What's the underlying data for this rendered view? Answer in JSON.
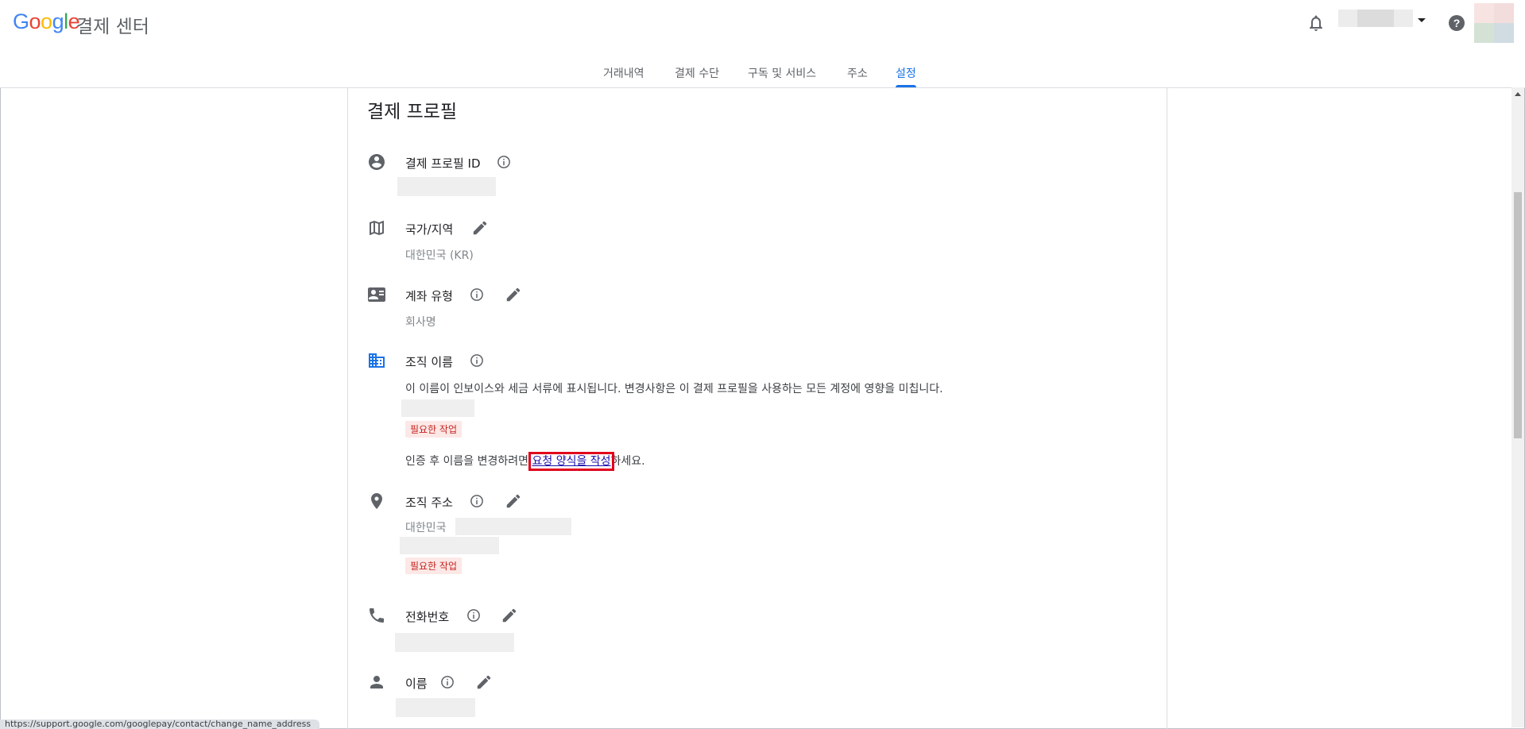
{
  "header": {
    "logo_letters": [
      {
        "ch": "G",
        "color": "#4285F4"
      },
      {
        "ch": "o",
        "color": "#EA4335"
      },
      {
        "ch": "o",
        "color": "#FBBC05"
      },
      {
        "ch": "g",
        "color": "#4285F4"
      },
      {
        "ch": "l",
        "color": "#34A853"
      },
      {
        "ch": "e",
        "color": "#EA4335"
      }
    ],
    "product_name": "결제 센터",
    "icons": {
      "notifications": "bell-icon",
      "help": "help-icon",
      "account_menu": "chevron-down-icon"
    }
  },
  "tabs": [
    {
      "label": "거래내역",
      "active": false
    },
    {
      "label": "결제 수단",
      "active": false
    },
    {
      "label": "구독 및 서비스",
      "active": false
    },
    {
      "label": "주소",
      "active": false
    },
    {
      "label": "설정",
      "active": true
    }
  ],
  "section": {
    "title": "결제 프로필",
    "profile_id": {
      "label": "결제 프로필 ID"
    },
    "country": {
      "label": "국가/지역",
      "value": "대한민국 (KR)"
    },
    "account_type": {
      "label": "계좌 유형",
      "value": "회사명"
    },
    "org_name": {
      "label": "조직 이름",
      "description": "이 이름이 인보이스와 세금 서류에 표시됩니다. 변경사항은 이 결제 프로필을 사용하는 모든 계정에 영향을 미칩니다.",
      "badge": "필요한 작업",
      "change_prefix": "인증 후 이름을 변경하려면 ",
      "change_link": "요청 양식을 작성",
      "change_suffix": "하세요."
    },
    "org_address": {
      "label": "조직 주소",
      "value": "대한민국",
      "badge": "필요한 작업"
    },
    "phone": {
      "label": "전화번호"
    },
    "name": {
      "label": "이름"
    }
  },
  "status_bar": {
    "url": "https://support.google.com/googlepay/contact/change_name_address"
  },
  "colors": {
    "accent": "#1a73e8",
    "link": "#1a0dab",
    "highlight_box": "#e0001b",
    "badge_text": "#c5221f",
    "badge_bg": "#fce8e6"
  }
}
